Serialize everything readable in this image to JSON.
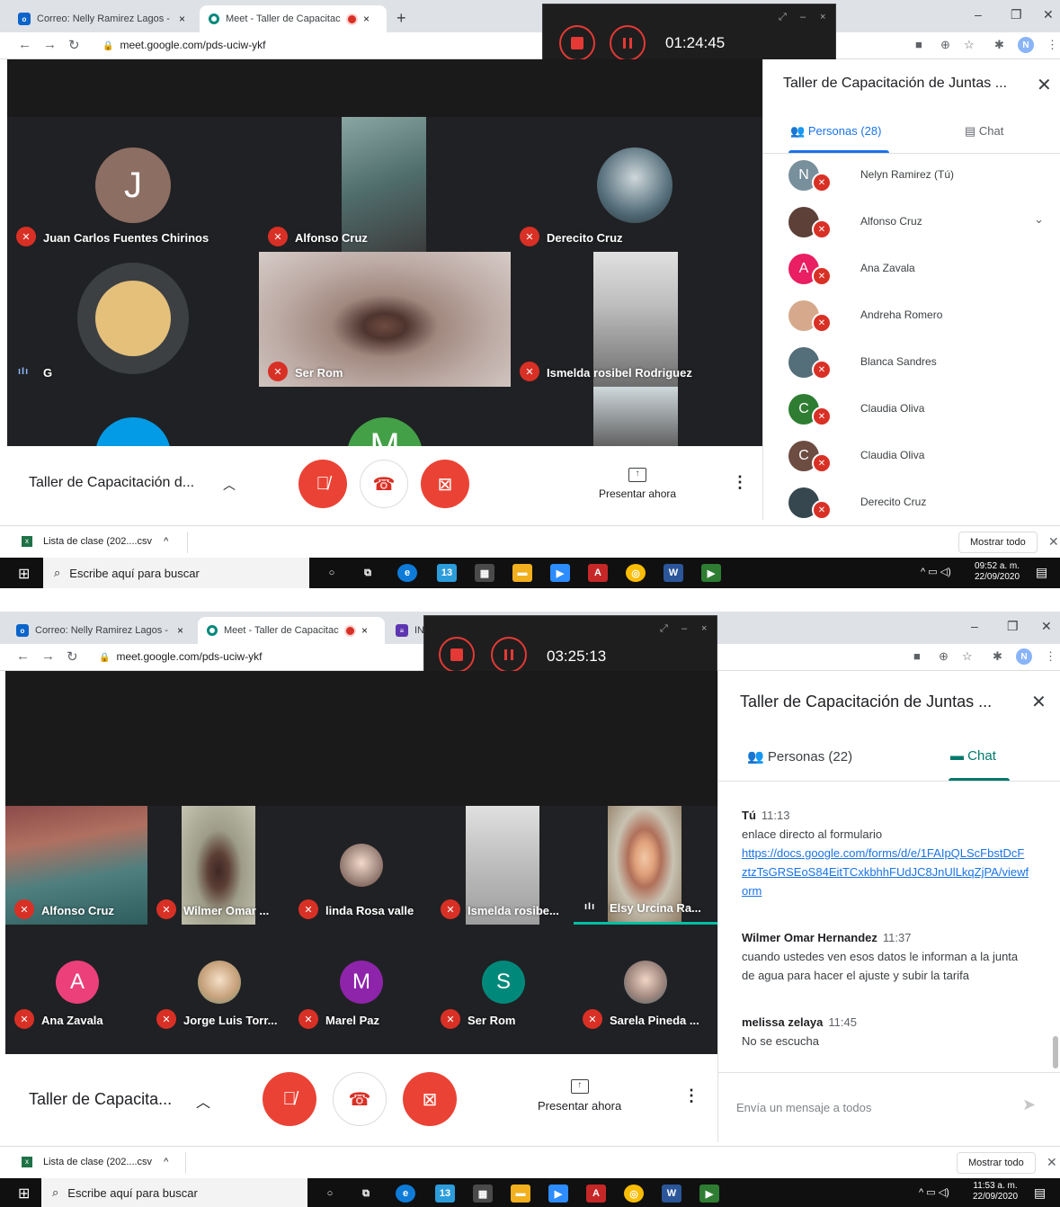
{
  "top": {
    "browser": {
      "tabs": [
        {
          "label": "Correo: Nelly Ramirez Lagos - Ou",
          "close": "×"
        },
        {
          "label": "Meet - Taller de Capacitación",
          "close": "×"
        }
      ],
      "new_tab": "+",
      "url": "meet.google.com/pds-uciw-ykf",
      "profile_initial": "N"
    },
    "recorder": {
      "elapsed": "01:24:45"
    },
    "tiles": [
      {
        "name": "Juan Carlos Fuentes Chirinos",
        "initial": "J",
        "avatar_color": "#8d6e63"
      },
      {
        "name": "Alfonso Cruz"
      },
      {
        "name": "Derecito Cruz"
      },
      {
        "name": "G",
        "avatar_color": "#e5c07b"
      },
      {
        "name": "Ser Rom"
      },
      {
        "name": "Ismelda rosibel Rodriguez"
      },
      {
        "initial": "M",
        "avatar_color": "#43a047"
      }
    ],
    "controls": {
      "meeting_name": "Taller de Capacitación d...",
      "present": "Presentar ahora"
    },
    "side": {
      "title": "Taller de Capacitación de Juntas ...",
      "tab_people": "Personas (28)",
      "tab_chat": "Chat",
      "people": [
        {
          "name": "Nelyn Ramirez (Tú)",
          "initial": "N",
          "color": "#78909c"
        },
        {
          "name": "Alfonso Cruz",
          "initial": "",
          "color": "#5d4037"
        },
        {
          "name": "Ana Zavala",
          "initial": "A",
          "color": "#e91e63"
        },
        {
          "name": "Andreha Romero",
          "initial": "",
          "color": "#d7a98c"
        },
        {
          "name": "Blanca Sandres",
          "initial": "",
          "color": "#546e7a"
        },
        {
          "name": "Claudia Oliva",
          "initial": "C",
          "color": "#2e7d32"
        },
        {
          "name": "Claudia Oliva",
          "initial": "C",
          "color": "#6d4c41"
        },
        {
          "name": "Derecito Cruz",
          "initial": "",
          "color": "#37474f"
        }
      ]
    },
    "download": {
      "file": "Lista de clase (202....csv",
      "show_all": "Mostrar todo"
    },
    "taskbar": {
      "search": "Escribe aquí para buscar",
      "time": "09:52 a. m.",
      "date": "22/09/2020",
      "badge": "13"
    }
  },
  "bottom": {
    "browser": {
      "tabs": [
        {
          "label": "Correo: Nelly Ramirez Lagos - Ou",
          "close": "×"
        },
        {
          "label": "Meet - Taller de Capacitación",
          "close": "×"
        },
        {
          "label": "INF"
        }
      ],
      "url": "meet.google.com/pds-uciw-ykf",
      "profile_initial": "N"
    },
    "recorder": {
      "elapsed": "03:25:13"
    },
    "tiles": [
      {
        "name": "Alfonso Cruz"
      },
      {
        "name": "Wilmer Omar ..."
      },
      {
        "name": "linda Rosa valle"
      },
      {
        "name": "Ismelda rosibe..."
      },
      {
        "name": "Elsy Urcina Ra..."
      },
      {
        "name": "Ana Zavala",
        "initial": "A",
        "avatar_color": "#ec407a"
      },
      {
        "name": "Jorge Luis Torr..."
      },
      {
        "name": "Marel Paz",
        "initial": "M",
        "avatar_color": "#8e24aa"
      },
      {
        "name": "Ser Rom",
        "initial": "S",
        "avatar_color": "#00897b"
      },
      {
        "name": "Sarela Pineda ..."
      }
    ],
    "controls": {
      "meeting_name": "Taller de Capacita...",
      "present": "Presentar ahora"
    },
    "side": {
      "title": "Taller de Capacitación de Juntas ...",
      "tab_people": "Personas (22)",
      "tab_chat": "Chat",
      "messages": [
        {
          "author": "Tú",
          "time": "11:13",
          "text": "enlace directo al formulario",
          "link": "https://docs.google.com/forms/d/e/1FAIpQLScFbstDcFztzTsGRSEoS84EitTCxkbhhFUdJC8JnUlLkqZjPA/viewform"
        },
        {
          "author": "Wilmer Omar Hernandez",
          "time": "11:37",
          "text": "cuando ustedes ven esos datos le informan a la junta de agua para hacer el ajuste y subir la tarifa"
        },
        {
          "author": "melissa zelaya",
          "time": "11:45",
          "text": "No se escucha"
        }
      ],
      "input_placeholder": "Envía un mensaje a todos"
    },
    "download": {
      "file": "Lista de clase (202....csv",
      "show_all": "Mostrar todo"
    },
    "taskbar": {
      "search": "Escribe aquí para buscar",
      "time": "11:53 a. m.",
      "date": "22/09/2020",
      "badge": "13"
    }
  },
  "icons": {
    "mic_off": "mic-off-icon",
    "hangup": "phone-hangup-icon",
    "cam_off": "camera-off-icon",
    "people": "people-icon",
    "chat": "chat-icon",
    "send": "send-icon"
  },
  "colors": {
    "meet_red": "#ea4335",
    "meet_blue": "#1a73e8",
    "meet_green": "#00796b",
    "stage": "#202124"
  }
}
